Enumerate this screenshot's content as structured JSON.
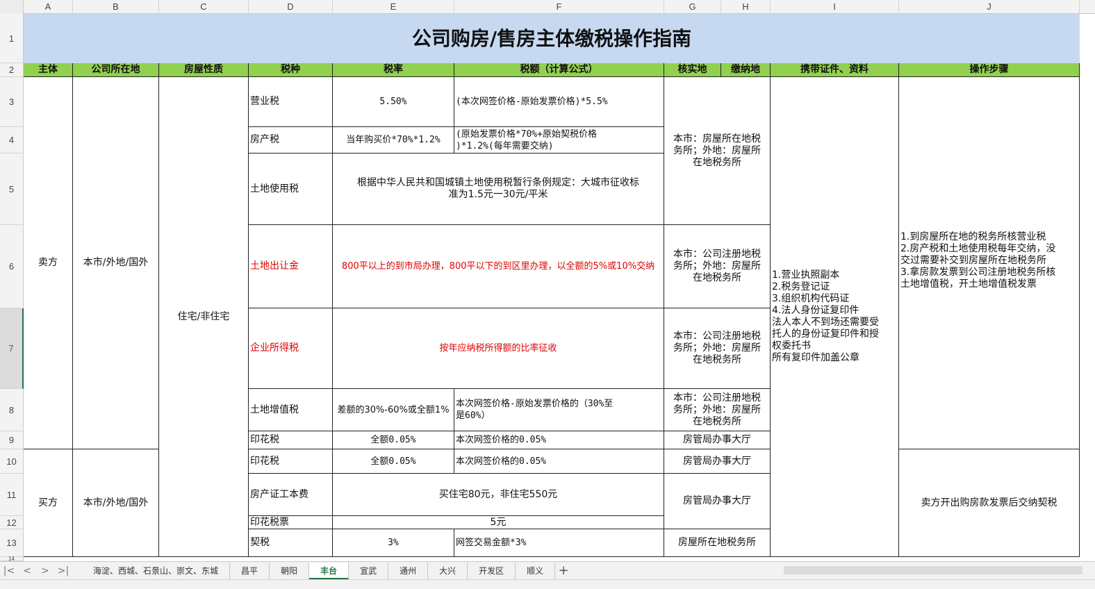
{
  "columns": [
    "A",
    "B",
    "C",
    "D",
    "E",
    "F",
    "G",
    "H",
    "I",
    "J"
  ],
  "rows": [
    "1",
    "2",
    "3",
    "4",
    "5",
    "6",
    "7",
    "8",
    "9",
    "10",
    "11",
    "12",
    "13",
    "14"
  ],
  "title": "公司购房/售房主体缴税操作指南",
  "headers": {
    "subject": "主体",
    "location": "公司所在地",
    "nature": "房屋性质",
    "tax_type": "税种",
    "rate": "税率",
    "amount": "税额（计算公式）",
    "verify_place": "核实地",
    "pay_place": "缴纳地",
    "documents": "携带证件、资料",
    "steps": "操作步骤"
  },
  "seller": {
    "subject": "卖方",
    "location": "本市/外地/国外",
    "nature": "住宅/非住宅",
    "rows": [
      {
        "tax": "营业税",
        "rate": "5.50%",
        "amount": "(本次网签价格-原始发票价格)*5.5%"
      },
      {
        "tax": "房产税",
        "rate": "当年购买价*70%*1.2%",
        "amount": "(原始发票价格*70%+原始契税价格\n)*1.2%(每年需要交纳)"
      },
      {
        "tax": "土地使用税",
        "merged": "根据中华人民共和国城镇土地使用税暂行条例规定：大城市征收标\n准为1.5元一30元/平米"
      },
      {
        "tax": "土地出让金",
        "merged": "800平以上的到市局办理，800平以下的到区里办理，以全额的5%或10%交纳"
      },
      {
        "tax": "企业所得税",
        "merged": "按年应纳税所得额的比率征收"
      },
      {
        "tax": "土地增值税",
        "rate": "差额的30%-60%或全额1%",
        "amount": "本次网签价格-原始发票价格的（30%至\n是60%）"
      },
      {
        "tax": "印花税",
        "rate": "全额0.05%",
        "amount": "本次网签价格的0.05%"
      }
    ],
    "place_a": "本市：房屋所在地税\n务所；外地：房屋所\n在地税务所",
    "place_b": "本市：公司注册地税\n务所；外地：房屋所\n在地税务所",
    "place_c": "本市：公司注册地税\n务所；外地：房屋所\n在地税务所",
    "place_d": "本市：公司注册地税\n务所；外地：房屋所\n在地税务所",
    "place_e": "房管局办事大厅",
    "documents": "1.营业执照副本\n2.税务登记证\n3.组织机构代码证\n4.法人身份证复印件\n法人本人不到场还需要受\n托人的身份证复印件和授\n权委托书\n所有复印件加盖公章",
    "steps": "1.到房屋所在地的税务所核营业税\n2.房产税和土地使用税每年交纳，没\n交过需要补交到房屋所在地税务所\n3.拿房款发票到公司注册地税务所核\n土地增值税，开土地增值税发票"
  },
  "buyer": {
    "subject": "买方",
    "location": "本市/外地/国外",
    "rows": [
      {
        "tax": "印花税",
        "rate": "全额0.05%",
        "amount": "本次网签价格的0.05%",
        "place": "房管局办事大厅"
      },
      {
        "tax": "房产证工本费",
        "merged": "买住宅80元，非住宅550元"
      },
      {
        "tax": "印花税票",
        "merged": "5元"
      },
      {
        "tax": "契税",
        "rate": "3%",
        "amount": "网签交易金额*3%",
        "place": "房屋所在地税务所"
      }
    ],
    "place_b": "房管局办事大厅",
    "steps": "卖方开出购房款发票后交纳契税"
  },
  "sheet_tabs": [
    "海淀、西城、石景山、崇文、东城",
    "昌平",
    "朝阳",
    "丰台",
    "宣武",
    "通州",
    "大兴",
    "开发区",
    "顺义"
  ],
  "active_tab": "丰台",
  "nav_icons": [
    "first-sheet-icon",
    "prev-sheet-icon",
    "next-sheet-icon",
    "last-sheet-icon"
  ],
  "add_sheet_symbol": "+",
  "colors": {
    "title_bg": "#c6d9f1",
    "header_bg": "#92d050",
    "accent": "#217346",
    "red_text": "#e00000"
  }
}
